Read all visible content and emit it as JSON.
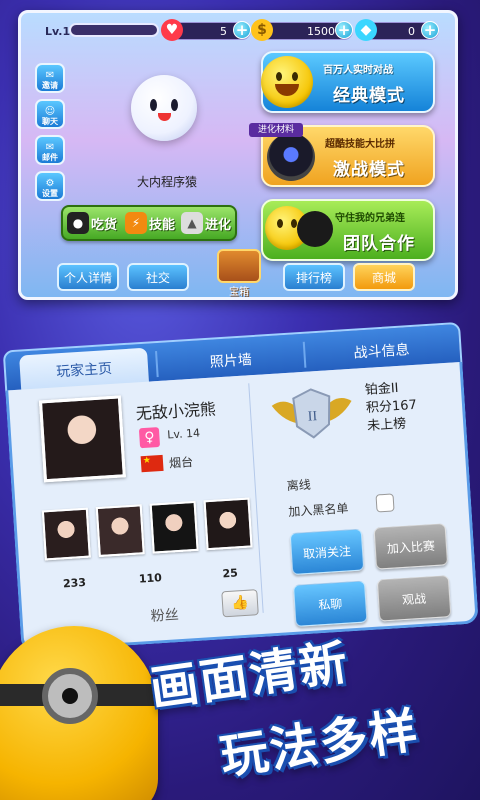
{
  "top_panel": {
    "level": "Lv.1",
    "hearts": "5",
    "coins": "1500",
    "gems": "0",
    "side_menu": [
      "邀请",
      "聊天",
      "邮件",
      "设置"
    ],
    "mascot_name": "大内程序猿",
    "abilities": [
      "吃货",
      "技能",
      "进化"
    ],
    "modes": {
      "classic": {
        "subtitle": "百万人实时对战",
        "title": "经典模式"
      },
      "combat": {
        "tag": "进化材料",
        "subtitle": "超酷技能大比拼",
        "title": "激战模式"
      },
      "team": {
        "subtitle": "守住我的兄弟连",
        "title": "团队合作"
      }
    },
    "nav": {
      "profile": "个人详情",
      "social": "社交",
      "chest": "宝箱",
      "leaderboard": "排行榜",
      "shop": "商城"
    }
  },
  "profile": {
    "tabs": [
      "玩家主页",
      "照片墙",
      "战斗信息"
    ],
    "name": "无敌小浣熊",
    "gender_icon": "♀",
    "level": "Lv. 14",
    "city": "烟台",
    "stats": [
      "233",
      "110",
      "25"
    ],
    "followers_label": "粉丝",
    "rank": {
      "tier": "铂金II",
      "points": "积分167",
      "board": "未上榜"
    },
    "status": "离线",
    "blacklist_label": "加入黑名单",
    "buttons": {
      "unfollow": "取消关注",
      "join_match": "加入比赛",
      "private_chat": "私聊",
      "spectate": "观战"
    }
  },
  "promo": {
    "line1": "画面清新",
    "line2": "玩法多样"
  },
  "colors": {
    "panel_blue": "#2a7fd0",
    "accent_orange": "#f29a0e",
    "green": "#46a924",
    "bg_purple": "#3b2fb0"
  }
}
